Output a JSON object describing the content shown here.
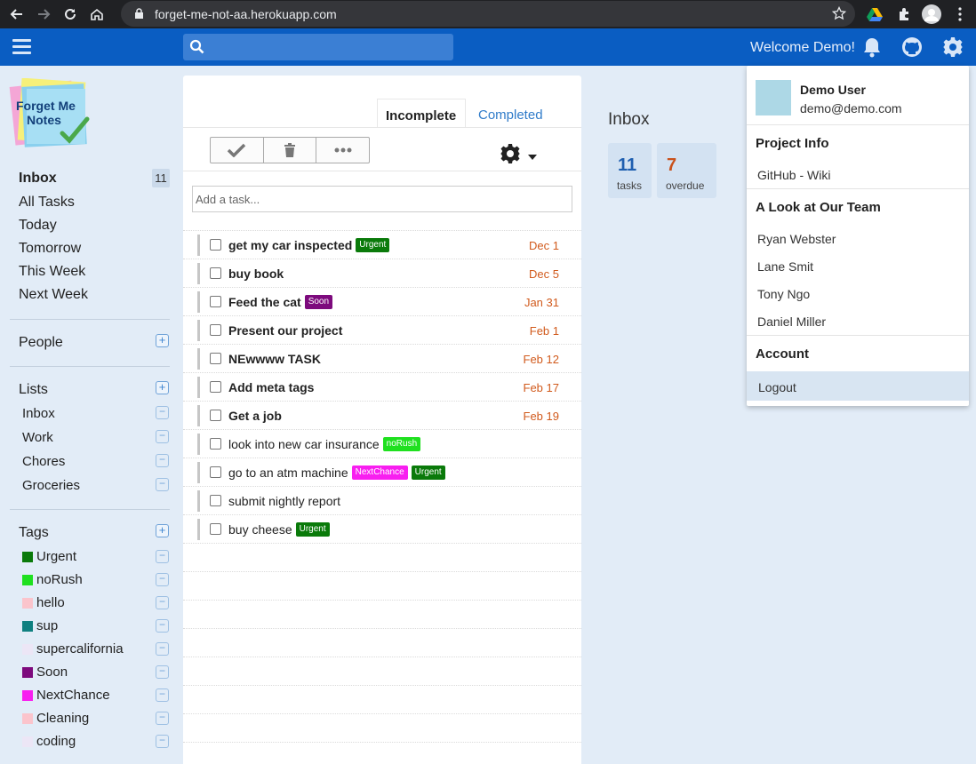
{
  "browser": {
    "url": "forget-me-not-aa.herokuapp.com"
  },
  "header": {
    "welcome": "Welcome Demo!",
    "search_placeholder": "",
    "colors": {
      "bar": "#0a5dc2",
      "search": "#3b7fd4"
    }
  },
  "logo": {
    "line1": "Forget Me",
    "line2": "Notes"
  },
  "sidebar": {
    "nav": [
      {
        "label": "Inbox",
        "count": "11"
      },
      {
        "label": "All Tasks"
      },
      {
        "label": "Today"
      },
      {
        "label": "Tomorrow"
      },
      {
        "label": "This Week"
      },
      {
        "label": "Next Week"
      }
    ],
    "people_label": "People",
    "lists_label": "Lists",
    "lists": [
      "Inbox",
      "Work",
      "Chores",
      "Groceries"
    ],
    "tags_label": "Tags",
    "tags": [
      {
        "name": "Urgent",
        "color": "#0a7a0a"
      },
      {
        "name": "noRush",
        "color": "#1fe01f"
      },
      {
        "name": "hello",
        "color": "#fbc4cc"
      },
      {
        "name": "sup",
        "color": "#0f8080"
      },
      {
        "name": "supercalifornia",
        "color": "#ece6f6"
      },
      {
        "name": "Soon",
        "color": "#7d0a7d"
      },
      {
        "name": "NextChance",
        "color": "#f81ef0"
      },
      {
        "name": "Cleaning",
        "color": "#fbc4cc"
      },
      {
        "name": "coding",
        "color": "#ece6f6"
      }
    ]
  },
  "tasks_panel": {
    "tabs": [
      "Incomplete",
      "Completed"
    ],
    "add_placeholder": "Add a task...",
    "tasks": [
      {
        "name": "get my car inspected",
        "bold": true,
        "tags": [
          {
            "label": "Urgent",
            "color": "#0a7a0a"
          }
        ],
        "due": "Dec 1"
      },
      {
        "name": "buy book",
        "bold": true,
        "tags": [],
        "due": "Dec 5"
      },
      {
        "name": "Feed the cat",
        "bold": true,
        "tags": [
          {
            "label": "Soon",
            "color": "#7d0a7d"
          }
        ],
        "due": "Jan 31"
      },
      {
        "name": "Present our project",
        "bold": true,
        "tags": [],
        "due": "Feb 1"
      },
      {
        "name": "NEwwww TASK",
        "bold": true,
        "tags": [],
        "due": "Feb 12"
      },
      {
        "name": "Add meta tags",
        "bold": true,
        "tags": [],
        "due": "Feb 17"
      },
      {
        "name": "Get a job",
        "bold": true,
        "tags": [],
        "due": "Feb 19"
      },
      {
        "name": "look into new car insurance",
        "bold": false,
        "tags": [
          {
            "label": "noRush",
            "color": "#1fe01f"
          }
        ],
        "due": ""
      },
      {
        "name": "go to an atm machine",
        "bold": false,
        "tags": [
          {
            "label": "NextChance",
            "color": "#f81ef0"
          },
          {
            "label": "Urgent",
            "color": "#0a7a0a"
          }
        ],
        "due": ""
      },
      {
        "name": "submit nightly report",
        "bold": false,
        "tags": [],
        "due": ""
      },
      {
        "name": "buy cheese",
        "bold": false,
        "tags": [
          {
            "label": "Urgent",
            "color": "#0a7a0a"
          }
        ],
        "due": ""
      }
    ]
  },
  "summary": {
    "title": "Inbox",
    "stats": [
      {
        "num": "11",
        "label": "tasks",
        "color": "#1f5fb0"
      },
      {
        "num": "7",
        "label": "overdue",
        "color": "#c9511b"
      }
    ]
  },
  "dropdown": {
    "user_name": "Demo User",
    "user_email": "demo@demo.com",
    "project_info": "Project Info",
    "project_link": "GitHub - Wiki",
    "team_header": "A Look at Our Team",
    "team": [
      "Ryan Webster",
      "Lane Smit",
      "Tony Ngo",
      "Daniel Miller"
    ],
    "account_header": "Account",
    "logout": "Logout"
  }
}
